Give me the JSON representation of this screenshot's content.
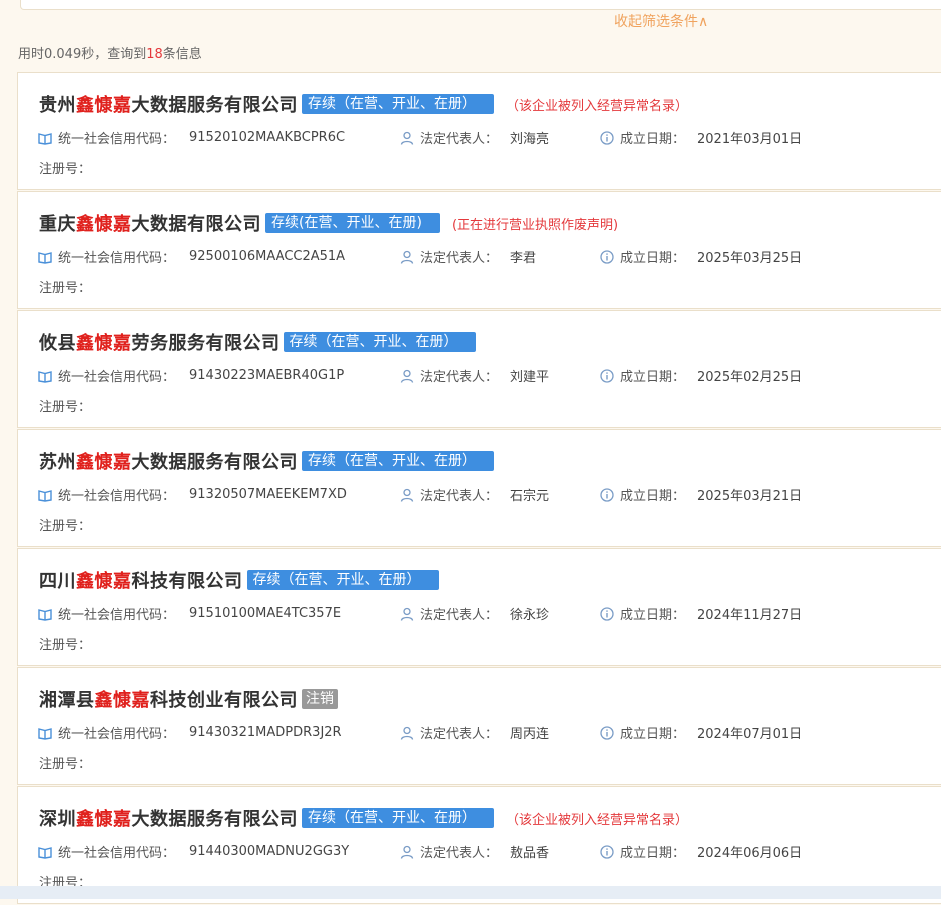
{
  "filter": {
    "collapse_label": "收起筛选条件∧"
  },
  "summary": {
    "prefix": "用时0.049秒，查询到",
    "count": "18",
    "suffix": "条信息"
  },
  "labels": {
    "credit_code": "统一社会信用代码：",
    "legal_rep": "法定代表人：",
    "founded": "成立日期：",
    "reg_no": "注册号："
  },
  "colors": {
    "highlight": "#e0211d",
    "badge_active": "#3e8ee0",
    "badge_cancelled": "#999999",
    "note": "#e4393c",
    "accent_link": "#f0a35e"
  },
  "results": [
    {
      "name_pre": "贵州",
      "name_hl": "鑫慷嘉",
      "name_post": "大数据服务有限公司",
      "status": "存续（在营、开业、在册）",
      "status_type": "active",
      "note": "（该企业被列入经营异常名录）",
      "credit_code": "91520102MAAKBCPR6C",
      "legal_rep": "刘海亮",
      "founded": "2021年03月01日"
    },
    {
      "name_pre": "重庆",
      "name_hl": "鑫慷嘉",
      "name_post": "大数据有限公司",
      "status": "存续(在营、开业、在册)",
      "status_type": "active",
      "note": "(正在进行营业执照作废声明)",
      "credit_code": "92500106MAACC2A51A",
      "legal_rep": "李君",
      "founded": "2025年03月25日"
    },
    {
      "name_pre": "攸县",
      "name_hl": "鑫慷嘉",
      "name_post": "劳务服务有限公司",
      "status": "存续（在营、开业、在册）",
      "status_type": "active",
      "note": "",
      "credit_code": "91430223MAEBR40G1P",
      "legal_rep": "刘建平",
      "founded": "2025年02月25日"
    },
    {
      "name_pre": "苏州",
      "name_hl": "鑫慷嘉",
      "name_post": "大数据服务有限公司",
      "status": "存续（在营、开业、在册）",
      "status_type": "active",
      "note": "",
      "credit_code": "91320507MAEEKEM7XD",
      "legal_rep": "石宗元",
      "founded": "2025年03月21日"
    },
    {
      "name_pre": "四川",
      "name_hl": "鑫慷嘉",
      "name_post": "科技有限公司",
      "status": "存续（在营、开业、在册）",
      "status_type": "active",
      "note": "",
      "credit_code": "91510100MAE4TC357E",
      "legal_rep": "徐永珍",
      "founded": "2024年11月27日"
    },
    {
      "name_pre": "湘潭县",
      "name_hl": "鑫慷嘉",
      "name_post": "科技创业有限公司",
      "status": "注销",
      "status_type": "cancelled",
      "note": "",
      "credit_code": "91430321MADPDR3J2R",
      "legal_rep": "周丙连",
      "founded": "2024年07月01日"
    },
    {
      "name_pre": "深圳",
      "name_hl": "鑫慷嘉",
      "name_post": "大数据服务有限公司",
      "status": "存续（在营、开业、在册）",
      "status_type": "active",
      "note": "（该企业被列入经营异常名录）",
      "credit_code": "91440300MADNU2GG3Y",
      "legal_rep": "敖品香",
      "founded": "2024年06月06日"
    }
  ]
}
